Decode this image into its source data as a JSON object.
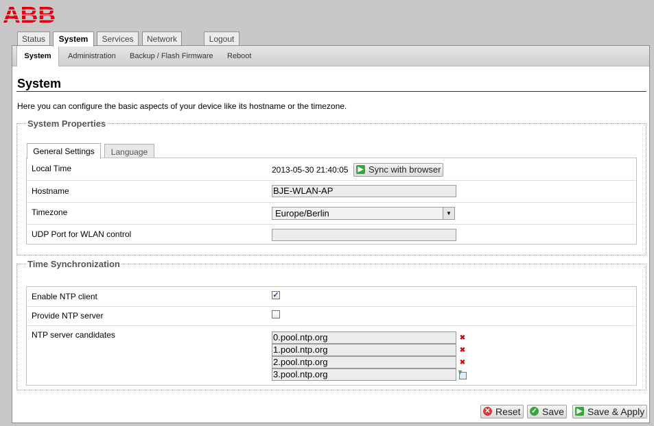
{
  "brand": {
    "logo_text": "ABB",
    "accent": "#e2000f"
  },
  "main_tabs": [
    "Status",
    "System",
    "Services",
    "Network",
    "Logout"
  ],
  "sub_tabs": [
    "System",
    "Administration",
    "Backup / Flash Firmware",
    "Reboot"
  ],
  "page": {
    "title": "System",
    "description": "Here you can configure the basic aspects of your device like its hostname or the timezone."
  },
  "system_properties": {
    "legend": "System Properties",
    "tabs": [
      "General Settings",
      "Language"
    ],
    "local_time_label": "Local Time",
    "local_time_value": "2013-05-30 21:40:05",
    "sync_button": "Sync with browser",
    "hostname_label": "Hostname",
    "hostname_value": "BJE-WLAN-AP",
    "timezone_label": "Timezone",
    "timezone_value": "Europe/Berlin",
    "udp_label": "UDP Port for WLAN control",
    "udp_value": ""
  },
  "time_sync": {
    "legend": "Time Synchronization",
    "ntp_client_label": "Enable NTP client",
    "ntp_client_checked": true,
    "ntp_server_label": "Provide NTP server",
    "ntp_server_checked": false,
    "candidates_label": "NTP server candidates",
    "candidates": [
      "0.pool.ntp.org",
      "1.pool.ntp.org",
      "2.pool.ntp.org",
      "3.pool.ntp.org"
    ]
  },
  "footer": {
    "reset": "Reset",
    "save": "Save",
    "save_apply": "Save & Apply"
  }
}
